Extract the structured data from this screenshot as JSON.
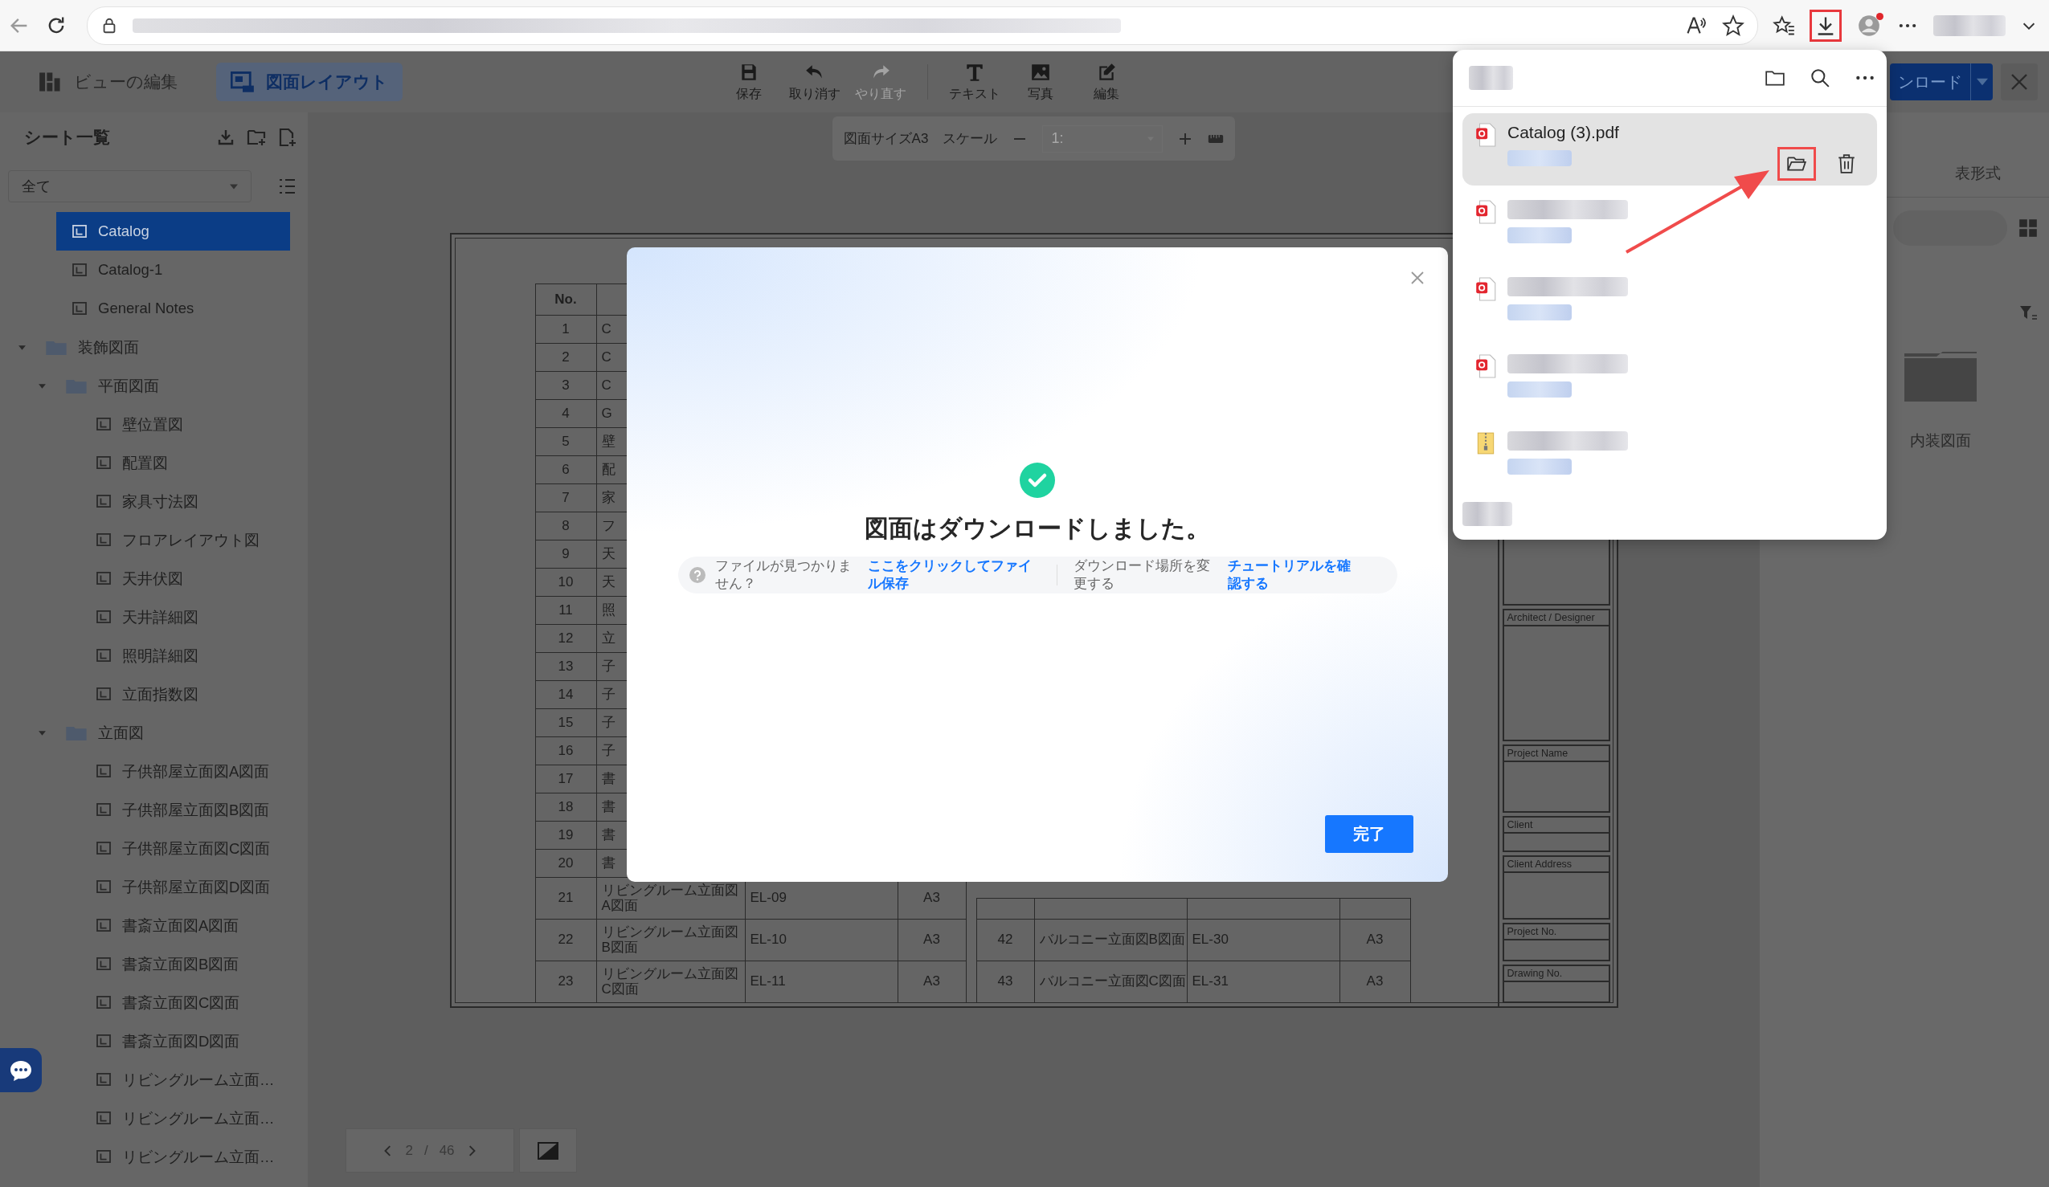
{
  "browser": {
    "download_button": {
      "highlighted": true
    },
    "profile": {
      "notification": true
    }
  },
  "toolbar": {
    "view_tabs": [
      {
        "kind": "view-edit",
        "label": "ビューの編集",
        "selected": false
      },
      {
        "kind": "layout",
        "label": "図面レイアウト",
        "selected": true
      }
    ],
    "edit_actions": [
      {
        "kind": "save",
        "label": "保存",
        "disabled": false
      },
      {
        "kind": "undo",
        "label": "取り消す",
        "disabled": false
      },
      {
        "kind": "redo",
        "label": "やり直す",
        "disabled": true
      }
    ],
    "insert_actions": [
      {
        "kind": "text",
        "label": "テキスト",
        "disabled": false
      },
      {
        "kind": "photo",
        "label": "写真",
        "disabled": false
      },
      {
        "kind": "edit",
        "label": "編集",
        "disabled": false
      }
    ],
    "download_button": "ンロード"
  },
  "sheet_list": {
    "title": "シート一覧",
    "filter": "全て",
    "tree": [
      {
        "kind": "sheet",
        "label": "Catalog",
        "selected": true
      },
      {
        "kind": "sheet",
        "label": "Catalog-1",
        "selected": false
      },
      {
        "kind": "sheet",
        "label": "General Notes",
        "selected": false
      },
      {
        "kind": "folder",
        "label": "装飾図面",
        "selected": false,
        "expanded": true,
        "children": [
          {
            "kind": "folder",
            "label": "平面図面",
            "selected": false,
            "expanded": true,
            "children": [
              {
                "kind": "sheet",
                "label": "壁位置図",
                "selected": false
              },
              {
                "kind": "sheet",
                "label": "配置図",
                "selected": false
              },
              {
                "kind": "sheet",
                "label": "家具寸法図",
                "selected": false
              },
              {
                "kind": "sheet",
                "label": "フロアレイアウト図",
                "selected": false
              },
              {
                "kind": "sheet",
                "label": "天井伏図",
                "selected": false
              },
              {
                "kind": "sheet",
                "label": "天井詳細図",
                "selected": false
              },
              {
                "kind": "sheet",
                "label": "照明詳細図",
                "selected": false
              },
              {
                "kind": "sheet",
                "label": "立面指数図",
                "selected": false
              }
            ]
          },
          {
            "kind": "folder",
            "label": "立面図",
            "selected": false,
            "expanded": true,
            "children": [
              {
                "kind": "sheet",
                "label": "子供部屋立面図A図面",
                "selected": false
              },
              {
                "kind": "sheet",
                "label": "子供部屋立面図B図面",
                "selected": false
              },
              {
                "kind": "sheet",
                "label": "子供部屋立面図C図面",
                "selected": false
              },
              {
                "kind": "sheet",
                "label": "子供部屋立面図D図面",
                "selected": false
              },
              {
                "kind": "sheet",
                "label": "書斎立面図A図面",
                "selected": false
              },
              {
                "kind": "sheet",
                "label": "書斎立面図B図面",
                "selected": false
              },
              {
                "kind": "sheet",
                "label": "書斎立面図C図面",
                "selected": false
              },
              {
                "kind": "sheet",
                "label": "書斎立面図D図面",
                "selected": false
              },
              {
                "kind": "sheet",
                "label": "リビングルーム立面…",
                "selected": false
              },
              {
                "kind": "sheet",
                "label": "リビングルーム立面…",
                "selected": false
              },
              {
                "kind": "sheet",
                "label": "リビングルーム立面…",
                "selected": false
              }
            ]
          }
        ]
      }
    ]
  },
  "canvas_toolbar": {
    "paper_size": "図面サイズA3",
    "scale_label": "スケール",
    "scale_value": "1:"
  },
  "drawing": {
    "catalog_table": {
      "header": "No.",
      "rows": [
        {
          "no": "1",
          "name": "C"
        },
        {
          "no": "2",
          "name": "C"
        },
        {
          "no": "3",
          "name": "C"
        },
        {
          "no": "4",
          "name": "G"
        },
        {
          "no": "5",
          "name": "壁"
        },
        {
          "no": "6",
          "name": "配"
        },
        {
          "no": "7",
          "name": "家"
        },
        {
          "no": "8",
          "name": "フ"
        },
        {
          "no": "9",
          "name": "天"
        },
        {
          "no": "10",
          "name": "天"
        },
        {
          "no": "11",
          "name": "照"
        },
        {
          "no": "12",
          "name": "立"
        },
        {
          "no": "13",
          "name": "子"
        },
        {
          "no": "14",
          "name": "子"
        },
        {
          "no": "15",
          "name": "子"
        },
        {
          "no": "16",
          "name": "子"
        },
        {
          "no": "17",
          "name": "書"
        },
        {
          "no": "18",
          "name": "書"
        },
        {
          "no": "19",
          "name": "書"
        },
        {
          "no": "20",
          "name": "書"
        },
        {
          "no": "21",
          "name": "リビングルーム立面図A図面",
          "code": "EL-09",
          "size": "A3"
        },
        {
          "no": "22",
          "name": "リビングルーム立面図B図面",
          "code": "EL-10",
          "size": "A3"
        },
        {
          "no": "23",
          "name": "リビングルーム立面図C図面",
          "code": "EL-11",
          "size": "A3"
        }
      ]
    },
    "continued_rows": [
      {
        "no": "42",
        "name": "バルコニー立面図B図面",
        "code": "EL-30",
        "size": "A3"
      },
      {
        "no": "43",
        "name": "バルコニー立面図C図面",
        "code": "EL-31",
        "size": "A3"
      }
    ],
    "title_block": [
      "Architect / Designer",
      "Project Name",
      "Client",
      "Client Address",
      "Project No.",
      "Drawing No."
    ]
  },
  "pagination": {
    "current": "2",
    "separator": "/",
    "total": "46"
  },
  "right_panel": {
    "view_tab": "表形式",
    "folders": [
      {
        "name": "内装図面"
      }
    ]
  },
  "dialog": {
    "title": "図面はダウンロードしました。",
    "hint": "ファイルが見つかりません？",
    "save_link": "ここをクリックしてファイル保存",
    "location_hint": "ダウンロード場所を変更する",
    "tutorial_link": "チュートリアルを確認する",
    "confirm": "完了"
  },
  "downloads": {
    "items": [
      {
        "kind": "pdf",
        "name": "Catalog (3).pdf",
        "selected": true,
        "callout": true
      },
      {
        "kind": "pdf",
        "selected": false,
        "callout": false
      },
      {
        "kind": "pdf",
        "selected": false,
        "callout": false
      },
      {
        "kind": "pdf",
        "selected": false,
        "callout": false
      },
      {
        "kind": "zip",
        "selected": false,
        "callout": false
      }
    ]
  }
}
